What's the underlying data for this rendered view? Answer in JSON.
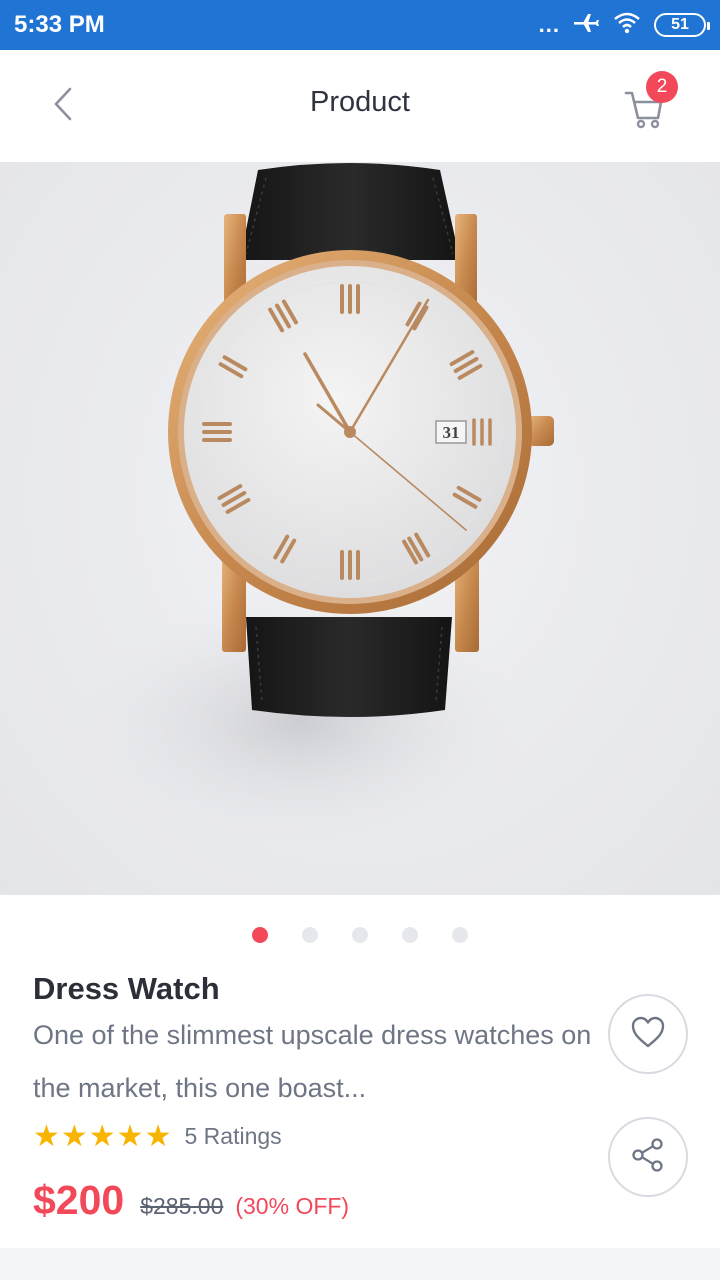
{
  "status_bar": {
    "time": "5:33 PM",
    "dots": "...",
    "battery_level": "51"
  },
  "header": {
    "title": "Product",
    "cart_count": "2"
  },
  "gallery": {
    "slide_count": 5,
    "active_index": 0,
    "watch_date": "31"
  },
  "product": {
    "name": "Dress Watch",
    "description": "One of the slimmest upscale dress watches on the market, this one boast...",
    "rating": 5,
    "stars": "★★★★★",
    "ratings_label": "5 Ratings",
    "price": "$200",
    "original_price": "$285.00",
    "discount": "(30% OFF)"
  },
  "colors": {
    "status_bar": "#1f74d4",
    "accent": "#f2485a",
    "star": "#f7b400",
    "title_text": "#2c2f38",
    "body_text": "#6e7585"
  },
  "icons": {
    "back": "chevron-left-icon",
    "cart": "cart-icon",
    "favorite": "heart-icon",
    "share": "share-icon",
    "airplane": "airplane-icon",
    "wifi": "wifi-icon"
  }
}
